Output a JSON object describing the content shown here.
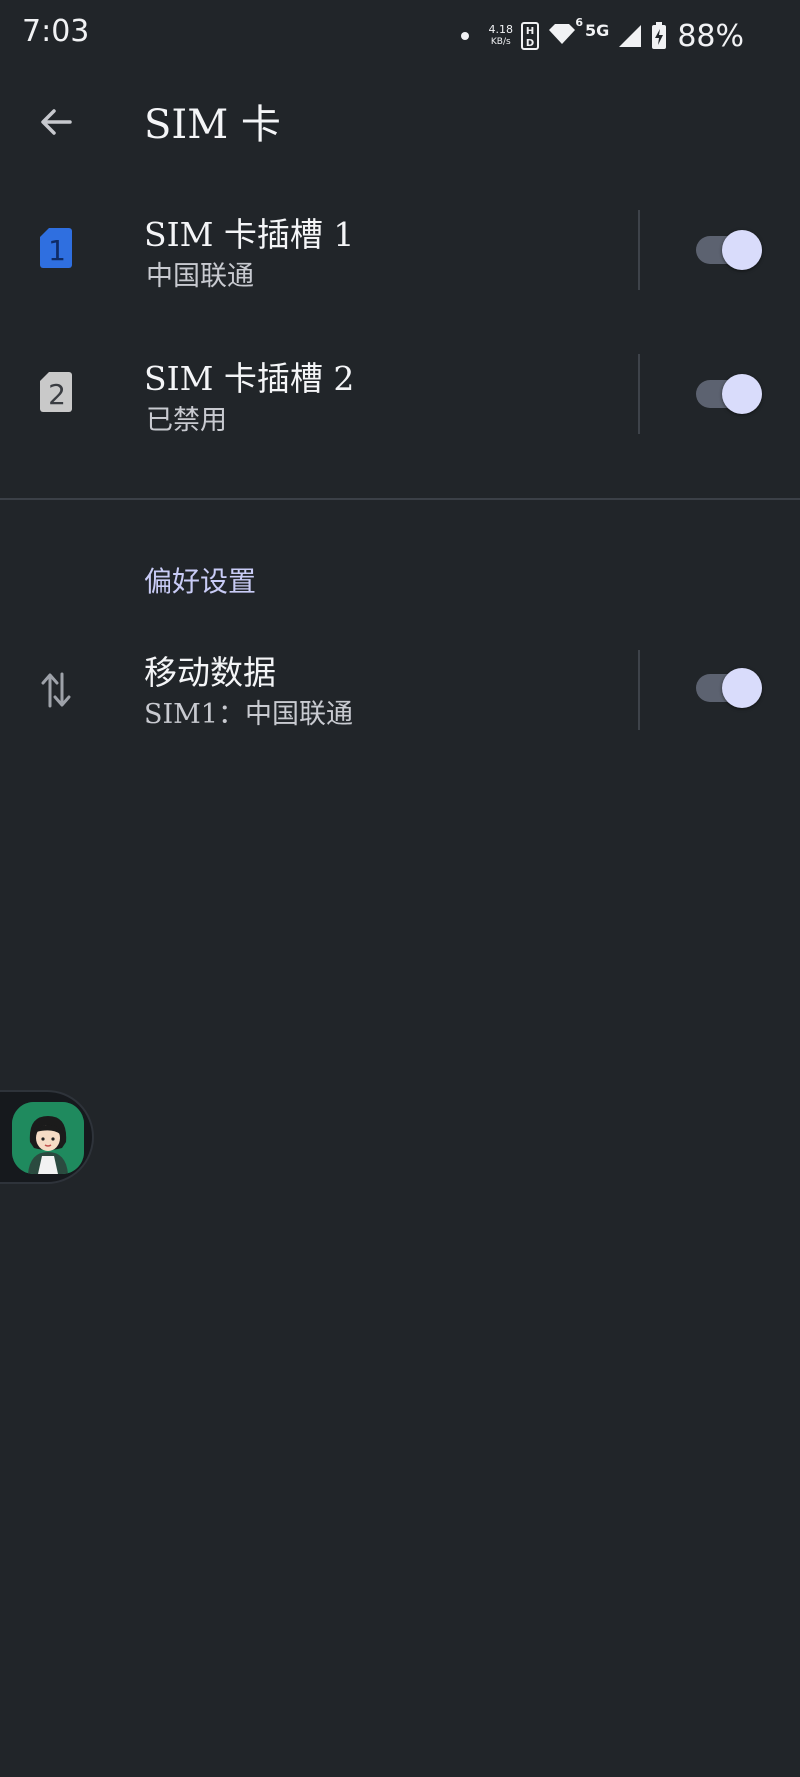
{
  "status_bar": {
    "time": "7:03",
    "net_speed_value": "4.18",
    "net_speed_unit": "KB/s",
    "network_type": "5G",
    "wifi_sub": "6",
    "battery_percent": "88%"
  },
  "app_bar": {
    "title": "SIM 卡"
  },
  "sims": [
    {
      "slot_number": "1",
      "title": "SIM 卡插槽 1",
      "subtitle": "中国联通",
      "enabled": true,
      "icon_color": "#2f6fe0"
    },
    {
      "slot_number": "2",
      "title": "SIM 卡插槽 2",
      "subtitle": "已禁用",
      "enabled": true,
      "icon_color": "#c9c9c9"
    }
  ],
  "preferences": {
    "header": "偏好设置",
    "mobile_data": {
      "title": "移动数据",
      "subtitle": "SIM1：中国联通",
      "enabled": true
    }
  },
  "colors": {
    "background": "#212529",
    "switch_thumb": "#d9dcfb",
    "accent_header": "#c9ccf6"
  }
}
